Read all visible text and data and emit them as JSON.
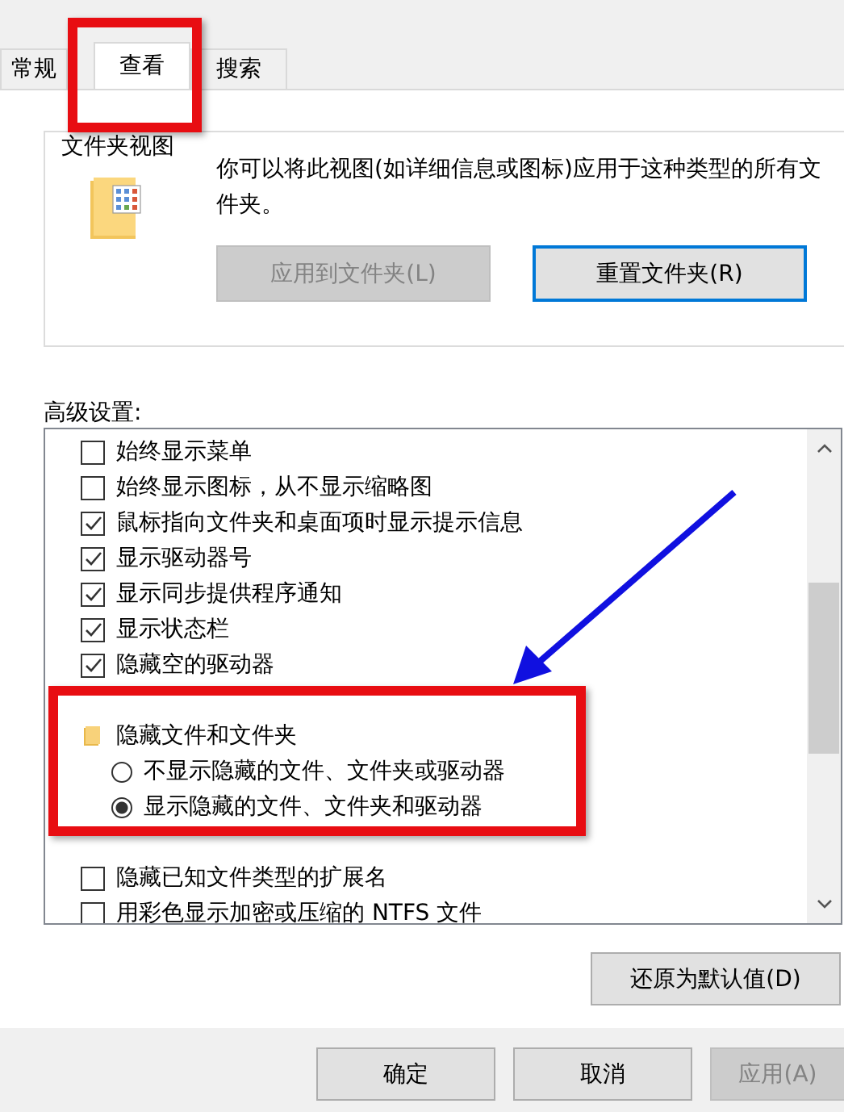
{
  "tabs": [
    {
      "label": "常规",
      "selected": false
    },
    {
      "label": "查看",
      "selected": true
    },
    {
      "label": "搜索",
      "selected": false
    }
  ],
  "folder_views": {
    "title": "文件夹视图",
    "description": "你可以将此视图(如详细信息或图标)应用于这种类型的所有文件夹。",
    "buttons": [
      {
        "label": "应用到文件夹(L)",
        "disabled": true,
        "focused": false
      },
      {
        "label": "重置文件夹(R)",
        "disabled": false,
        "focused": true
      }
    ]
  },
  "advanced": {
    "label": "高级设置:",
    "items": [
      {
        "kind": "checkbox",
        "label": "始终显示菜单",
        "checked": false
      },
      {
        "kind": "checkbox",
        "label": "始终显示图标，从不显示缩略图",
        "checked": false
      },
      {
        "kind": "checkbox",
        "label": "鼠标指向文件夹和桌面项时显示提示信息",
        "checked": true
      },
      {
        "kind": "checkbox",
        "label": "显示驱动器号",
        "checked": true
      },
      {
        "kind": "checkbox",
        "label": "显示同步提供程序通知",
        "checked": true
      },
      {
        "kind": "checkbox",
        "label": "显示状态栏",
        "checked": true
      },
      {
        "kind": "checkbox",
        "label": "隐藏空的驱动器",
        "checked": true
      },
      {
        "kind": "folder",
        "label": "隐藏文件和文件夹",
        "children": [
          {
            "kind": "radio",
            "label": "不显示隐藏的文件、文件夹或驱动器",
            "selected": false
          },
          {
            "kind": "radio",
            "label": "显示隐藏的文件、文件夹和驱动器",
            "selected": true
          }
        ]
      },
      {
        "kind": "checkbox",
        "label": "隐藏已知文件类型的扩展名",
        "checked": false
      },
      {
        "kind": "checkbox",
        "label": "用彩色显示加密或压缩的 NTFS 文件",
        "checked": false
      }
    ]
  },
  "restore_button": "还原为默认值(D)",
  "footer_buttons": [
    {
      "label": "确定",
      "disabled": false
    },
    {
      "label": "取消",
      "disabled": false
    },
    {
      "label": "应用(A)",
      "disabled": true
    }
  ]
}
